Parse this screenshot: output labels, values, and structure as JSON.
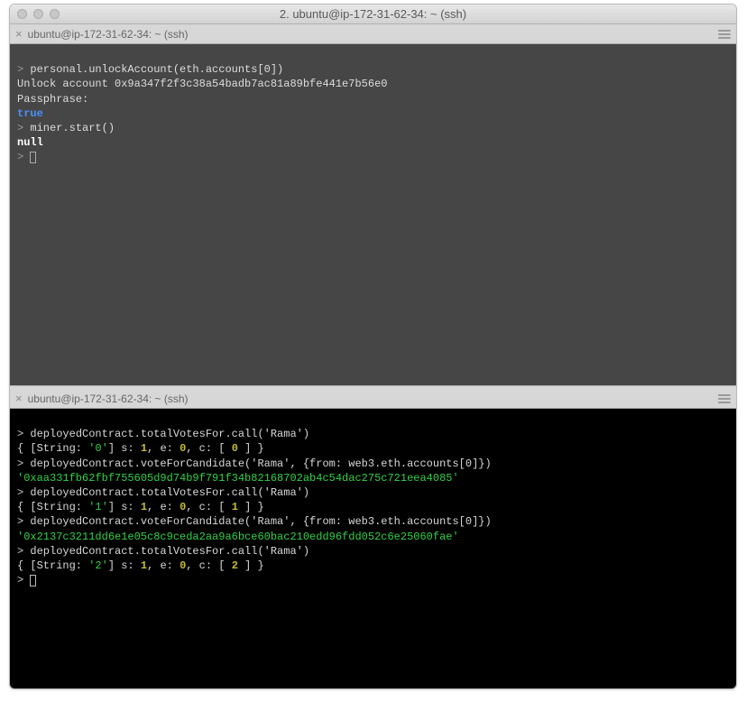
{
  "window": {
    "title": "2. ubuntu@ip-172-31-62-34: ~ (ssh)"
  },
  "tabs": {
    "top_label": "ubuntu@ip-172-31-62-34: ~ (ssh)",
    "bottom_label": "ubuntu@ip-172-31-62-34: ~ (ssh)"
  },
  "top_pane": {
    "l1_prompt": "> ",
    "l1_cmd": "personal.unlockAccount(eth.accounts[0])",
    "l2": "Unlock account 0x9a347f2f3c38a54badb7ac81a89bfe441e7b56e0",
    "l3": "Passphrase:",
    "l4": "true",
    "l5_prompt": "> ",
    "l5_cmd": "miner.start()",
    "l6": "null",
    "l7_prompt": "> "
  },
  "bottom_pane": {
    "l1_prompt": "> ",
    "l1_cmd": "deployedContract.totalVotesFor.call('Rama')",
    "l2a": "{ [String: ",
    "l2b": "'0'",
    "l2c": "] s: ",
    "l2d": "1",
    "l2e": ", e: ",
    "l2f": "0",
    "l2g": ", c: [ ",
    "l2h": "0",
    "l2i": " ] }",
    "l3_prompt": "> ",
    "l3_cmd": "deployedContract.voteForCandidate('Rama', {from: web3.eth.accounts[0]})",
    "l4": "'0xaa331fb62fbf755605d9d74b9f791f34b82168702ab4c54dac275c721eea4085'",
    "l5_prompt": "> ",
    "l5_cmd": "deployedContract.totalVotesFor.call('Rama')",
    "l6a": "{ [String: ",
    "l6b": "'1'",
    "l6c": "] s: ",
    "l6d": "1",
    "l6e": ", e: ",
    "l6f": "0",
    "l6g": ", c: [ ",
    "l6h": "1",
    "l6i": " ] }",
    "l7_prompt": "> ",
    "l7_cmd": "deployedContract.voteForCandidate('Rama', {from: web3.eth.accounts[0]})",
    "l8": "'0x2137c3211dd6e1e05c8c9ceda2aa9a6bce60bac210edd96fdd052c6e25060fae'",
    "l9_prompt": "> ",
    "l9_cmd": "deployedContract.totalVotesFor.call('Rama')",
    "l10a": "{ [String: ",
    "l10b": "'2'",
    "l10c": "] s: ",
    "l10d": "1",
    "l10e": ", e: ",
    "l10f": "0",
    "l10g": ", c: [ ",
    "l10h": "2",
    "l10i": " ] }",
    "l11_prompt": "> "
  }
}
